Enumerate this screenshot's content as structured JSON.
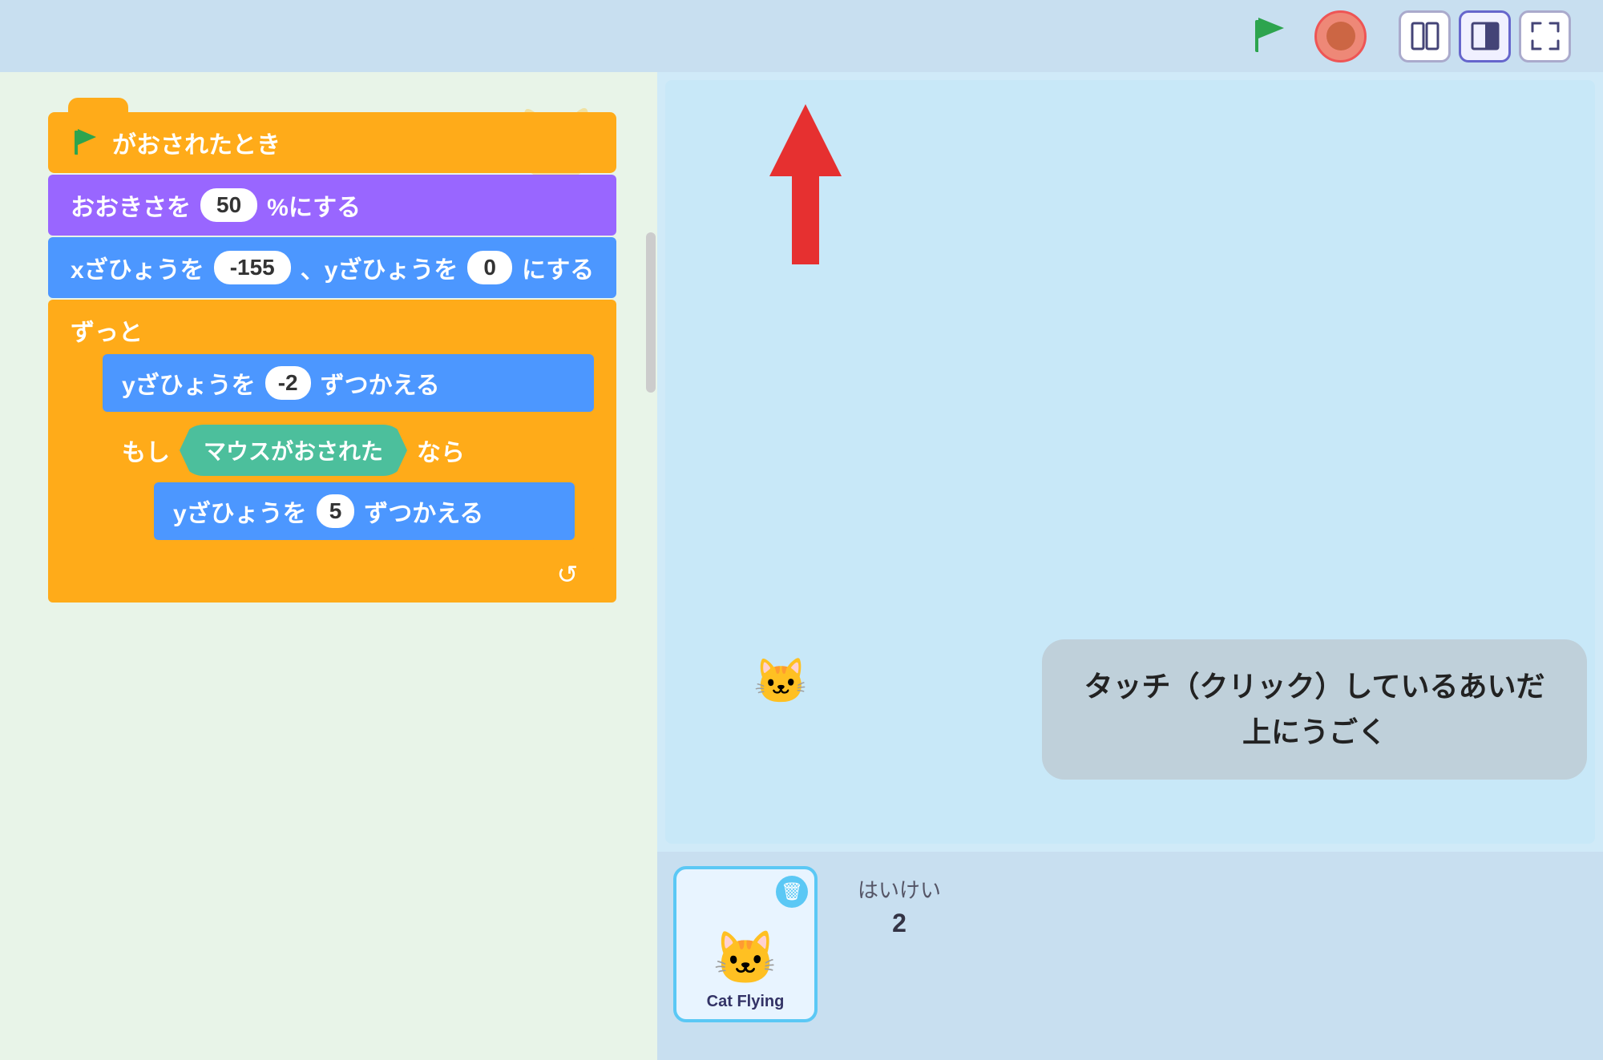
{
  "toolbar": {
    "green_flag_label": "▶",
    "stop_label": "⏹",
    "view_btn1": "⬜⬜",
    "view_btn2": "◧",
    "view_btn3": "⛶"
  },
  "blocks": {
    "hat_text": "がおされたとき",
    "size_block": "おおきさを",
    "size_value": "50",
    "size_unit": "%にする",
    "position_block": "xざひょうを",
    "x_value": "-155",
    "y_label": "、yざひょうを",
    "y_value": "0",
    "position_end": "にする",
    "loop_label": "ずっと",
    "y_change_label": "yざひょうを",
    "y_change_value": "-2",
    "y_change_end": "ずつかえる",
    "if_label": "もし",
    "condition_label": "マウスがおされた",
    "if_end": "なら",
    "y_change2_label": "yざひょうを",
    "y_change2_value": "5",
    "y_change2_end": "ずつかえる"
  },
  "tooltip": {
    "line1": "タッチ（クリック）しているあいだ",
    "line2": "上にうごく"
  },
  "sprite": {
    "name": "Cat Flying",
    "label": "はいけい",
    "value": "2"
  }
}
